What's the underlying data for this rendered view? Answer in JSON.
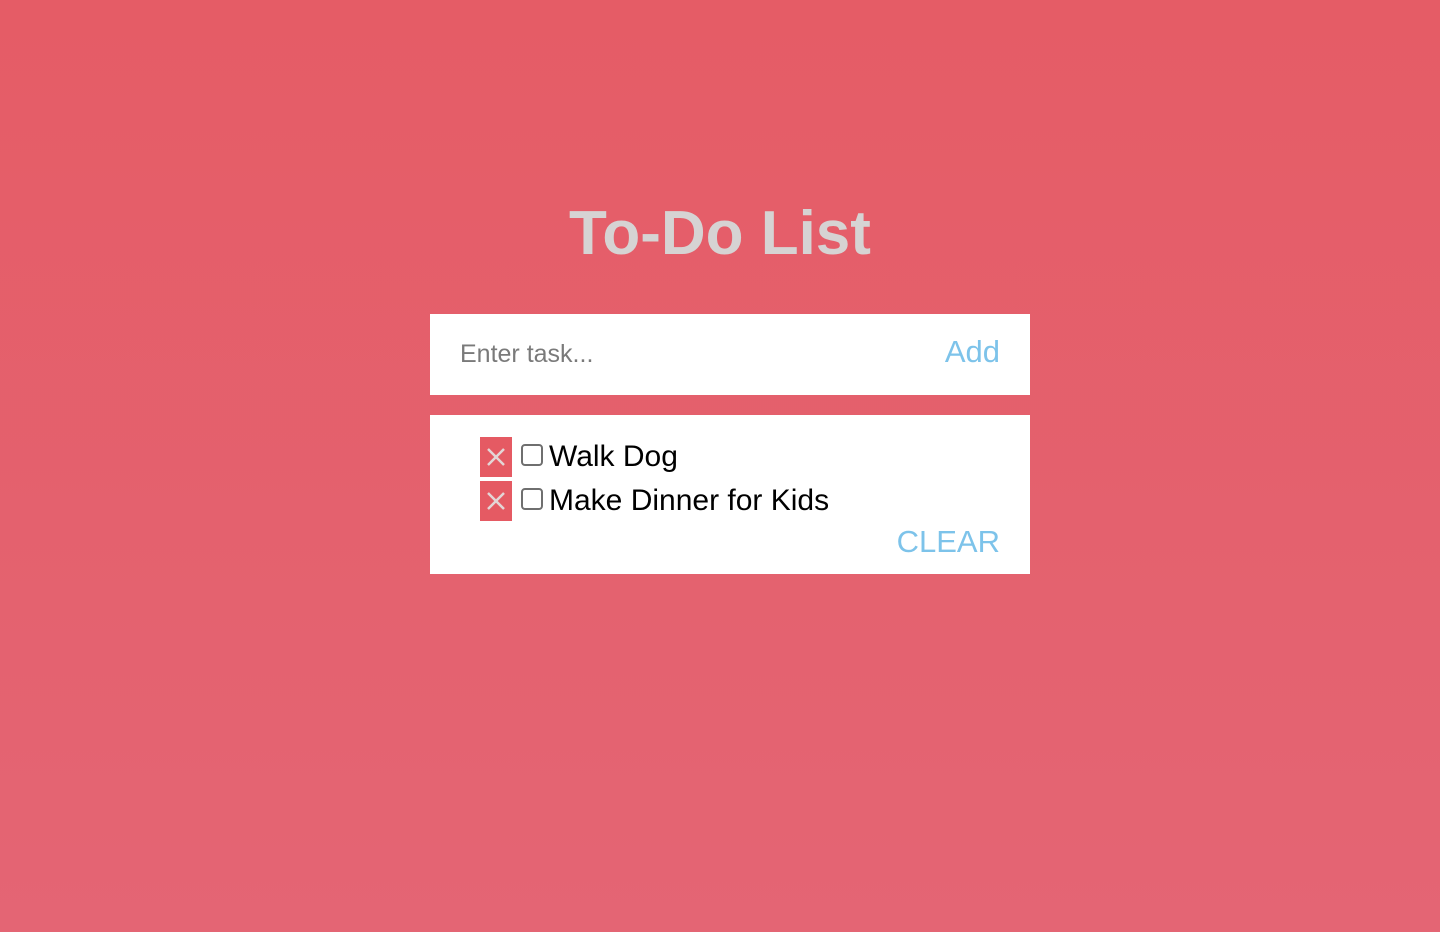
{
  "page": {
    "title": "To-Do List"
  },
  "entry": {
    "placeholder": "Enter task...",
    "value": "",
    "add_label": "Add"
  },
  "tasks": [
    {
      "label": "Walk Dog",
      "checked": false
    },
    {
      "label": "Make Dinner for Kids",
      "checked": false
    }
  ],
  "list": {
    "clear_label": "CLEAR"
  },
  "colors": {
    "background": "#e55c66",
    "title": "#d6d3d3",
    "accent": "#7dc3ea",
    "delete": "#e55a63"
  },
  "icons": {
    "delete": "close-icon",
    "checkbox": "checkbox-icon"
  }
}
